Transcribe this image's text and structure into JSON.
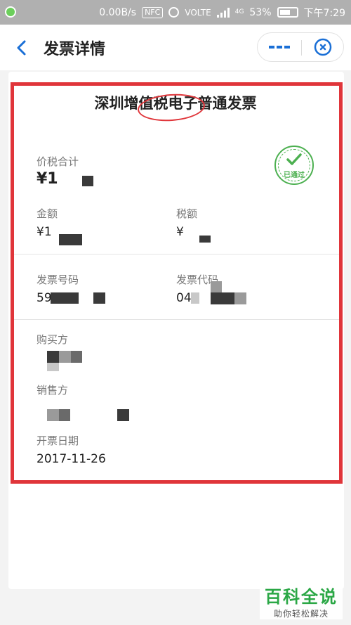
{
  "status_bar": {
    "speed": "0.00B/s",
    "nfc": "NFC",
    "volte": "VOLTE",
    "net": "4G",
    "battery": "53%",
    "time": "下午7:29"
  },
  "header": {
    "title": "发票详情"
  },
  "invoice": {
    "title": "深圳增值税电子普通发票",
    "stamp": "已通过",
    "total_label": "价税合计",
    "total_value": "¥1",
    "amount_label": "金额",
    "amount_value": "¥1",
    "tax_label": "税额",
    "tax_value": "¥",
    "number_label": "发票号码",
    "number_value": "59",
    "code_label": "发票代码",
    "code_value": "04",
    "buyer_label": "购买方",
    "seller_label": "销售方",
    "date_label": "开票日期",
    "date_value": "2017-11-26"
  },
  "colors": {
    "accent": "#1a6fd6",
    "highlight": "#e0353a",
    "verified": "#4cb050"
  },
  "watermark": {
    "main": "百科全说",
    "sub": "助你轻松解决"
  }
}
